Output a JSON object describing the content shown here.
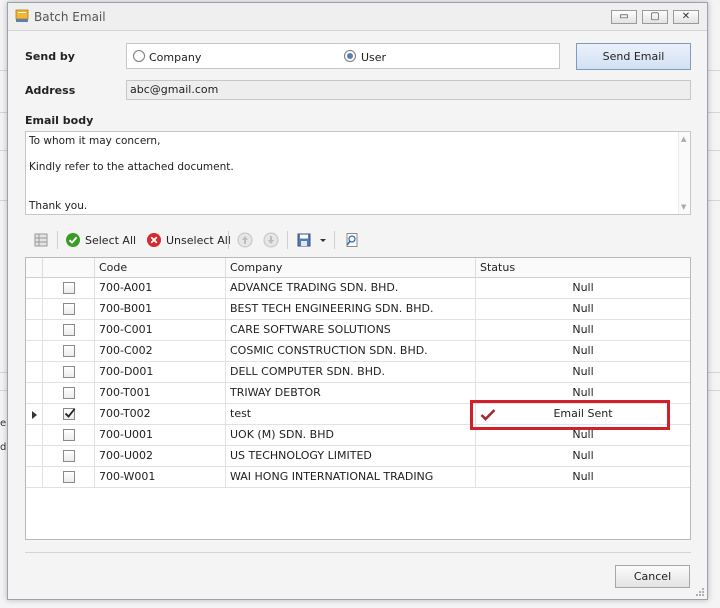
{
  "window": {
    "title": "Batch Email",
    "minimize": "▭",
    "maximize": "▢",
    "close": "✕"
  },
  "form": {
    "send_by_label": "Send by",
    "options": [
      {
        "label": "Company",
        "selected": false
      },
      {
        "label": "User",
        "selected": true
      }
    ],
    "send_button": "Send Email",
    "address_label": "Address",
    "address_value": "abc@gmail.com",
    "email_body_label": "Email body",
    "email_body_lines": [
      "To whom it may concern,",
      "Kindly refer to the attached document.",
      "Thank you."
    ]
  },
  "toolbar": {
    "select_all": "Select All",
    "unselect_all": "Unselect All",
    "icons": [
      "grid-icon",
      "check-circle-icon",
      "x-circle-icon",
      "arrow-up-icon",
      "arrow-down-icon",
      "save-icon",
      "dropdown-arrow-icon",
      "preview-icon"
    ]
  },
  "grid": {
    "columns": [
      "Code",
      "Company",
      "Status"
    ],
    "rows": [
      {
        "checked": false,
        "code": "700-A001",
        "company": "ADVANCE TRADING SDN. BHD.",
        "status": "Null"
      },
      {
        "checked": false,
        "code": "700-B001",
        "company": "BEST TECH ENGINEERING SDN. BHD.",
        "status": "Null"
      },
      {
        "checked": false,
        "code": "700-C001",
        "company": "CARE SOFTWARE SOLUTIONS",
        "status": "Null"
      },
      {
        "checked": false,
        "code": "700-C002",
        "company": "COSMIC CONSTRUCTION SDN. BHD.",
        "status": "Null"
      },
      {
        "checked": false,
        "code": "700-D001",
        "company": "DELL COMPUTER SDN. BHD.",
        "status": "Null"
      },
      {
        "checked": false,
        "code": "700-T001",
        "company": "TRIWAY DEBTOR",
        "status": "Null"
      },
      {
        "checked": true,
        "code": "700-T002",
        "company": "test",
        "status": "Email Sent"
      },
      {
        "checked": false,
        "code": "700-U001",
        "company": "UOK (M) SDN. BHD",
        "status": "Null"
      },
      {
        "checked": false,
        "code": "700-U002",
        "company": "US TECHNOLOGY LIMITED",
        "status": "Null"
      },
      {
        "checked": false,
        "code": "700-W001",
        "company": "WAI HONG INTERNATIONAL TRADING",
        "status": "Null"
      }
    ]
  },
  "footer": {
    "cancel": "Cancel"
  },
  "background": {
    "fragment_1": "e C",
    "fragment_2": "de"
  },
  "colors": {
    "highlight": "#d1202a",
    "check_green": "#3a9a2a",
    "x_red": "#d42a2a",
    "sent_check": "#a5282e"
  }
}
